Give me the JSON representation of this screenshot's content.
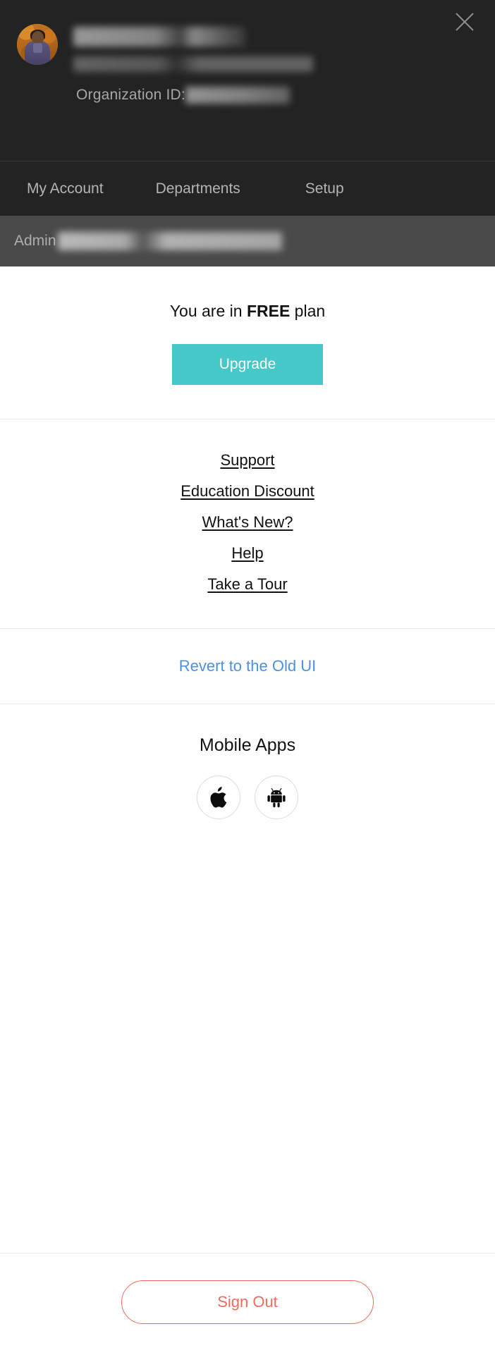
{
  "header": {
    "close_icon": "close-icon",
    "avatar_icon": "user-avatar-photo",
    "user_name_redacted": "",
    "user_email_redacted": "",
    "org_id_label": "Organization ID:",
    "org_id_value_redacted": "",
    "background_color": "#232323"
  },
  "tabs": [
    {
      "label": "My Account",
      "name": "tab-my-account"
    },
    {
      "label": "Departments",
      "name": "tab-departments"
    },
    {
      "label": "Setup",
      "name": "tab-setup"
    }
  ],
  "admin_bar": {
    "label": "Admin",
    "value_redacted": "",
    "background_color": "#4a4a4a"
  },
  "plan": {
    "prefix": "You are in ",
    "name": "FREE",
    "suffix": " plan",
    "upgrade_label": "Upgrade",
    "upgrade_color": "#45c8c7"
  },
  "links": [
    {
      "label": "Support",
      "name": "link-support"
    },
    {
      "label": "Education Discount",
      "name": "link-education-discount"
    },
    {
      "label": "What's New?",
      "name": "link-whats-new"
    },
    {
      "label": "Help",
      "name": "link-help"
    },
    {
      "label": "Take a Tour",
      "name": "link-take-a-tour"
    }
  ],
  "revert": {
    "label": "Revert to the Old UI",
    "color": "#4f90de"
  },
  "mobile_apps": {
    "title": "Mobile Apps",
    "stores": [
      {
        "icon": "apple-icon",
        "name": "app-store-button"
      },
      {
        "icon": "android-icon",
        "name": "play-store-button"
      }
    ]
  },
  "footer": {
    "signout_label": "Sign Out",
    "signout_color": "#ec6b5e"
  }
}
